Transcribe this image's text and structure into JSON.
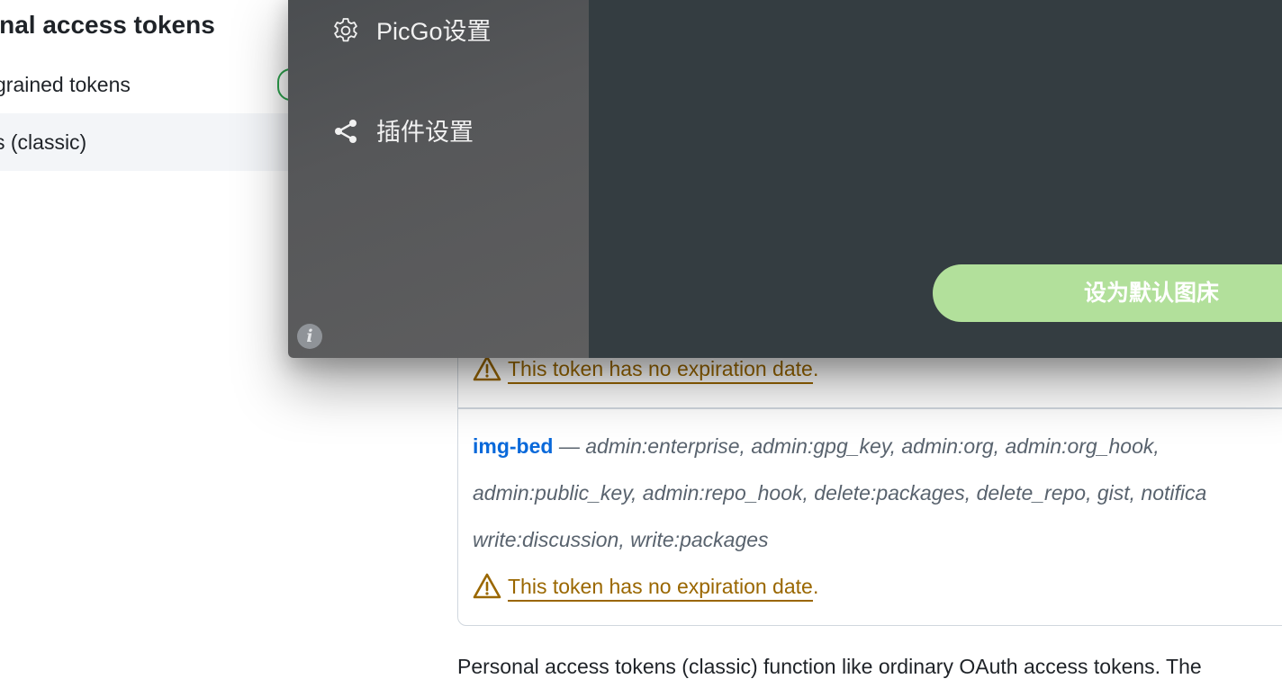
{
  "github": {
    "heading": "onal access tokens",
    "nav": {
      "fine_grained": "grained tokens",
      "classic": "s (classic)"
    },
    "tokens": [
      {
        "warning": "This token has no expiration date",
        "warning_period": "."
      },
      {
        "name": "img-bed",
        "separator": " — ",
        "scopes_line1": "admin:enterprise, admin:gpg_key, admin:org, admin:org_hook,",
        "scopes_line2": "admin:public_key, admin:repo_hook, delete:packages, delete_repo, gist, notifica",
        "scopes_line3": "write:discussion, write:packages",
        "warning": "This token has no expiration date",
        "warning_period": "."
      }
    ],
    "footer_text": "Personal access tokens (classic) function like ordinary OAuth access tokens. The"
  },
  "picgo": {
    "menu": [
      {
        "label": "PicGo设置",
        "icon": "gear-icon"
      },
      {
        "label": "插件设置",
        "icon": "share-icon"
      }
    ],
    "info_icon": "info-icon",
    "set_default_button": "设为默认图床",
    "colors": {
      "sidebar": "#565759",
      "main": "#343d41",
      "button": "#b2e09b"
    }
  }
}
